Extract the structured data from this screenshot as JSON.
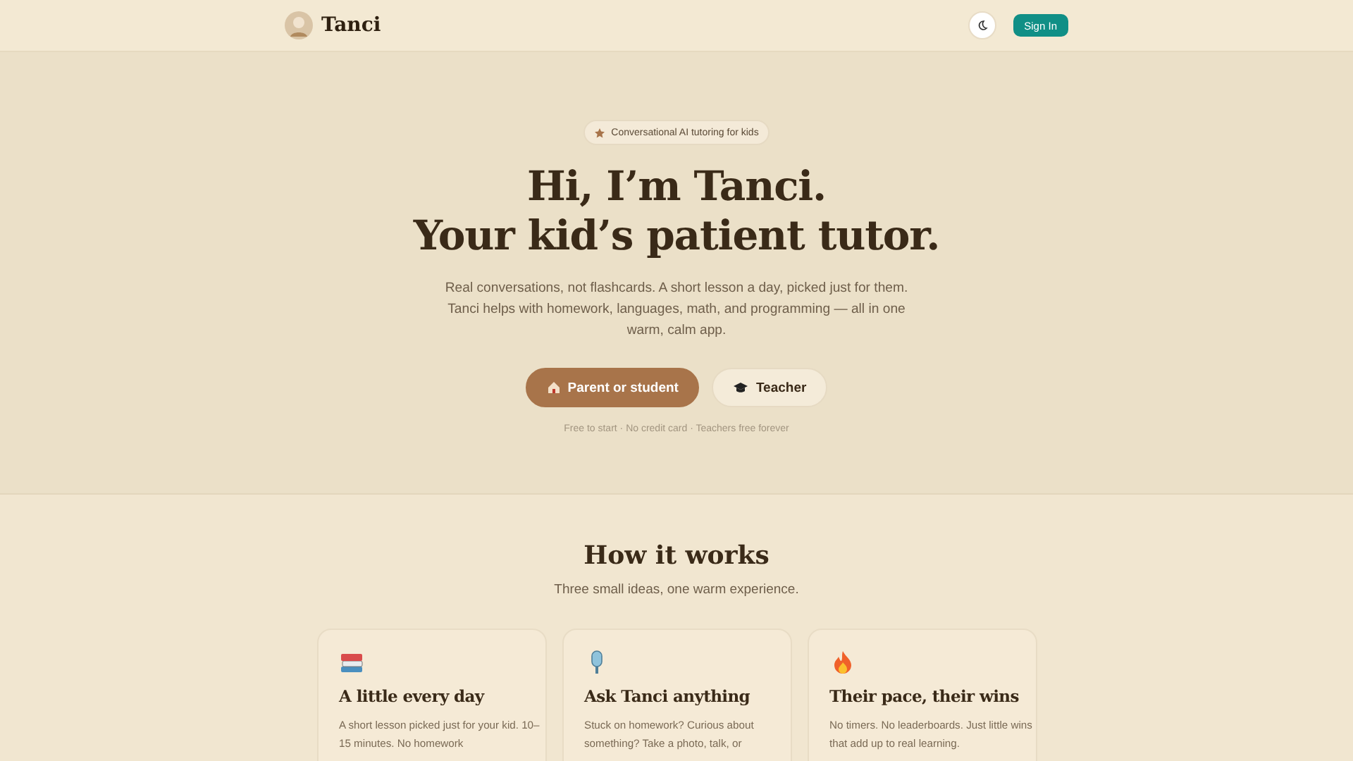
{
  "header": {
    "brand": "Tanci",
    "sign_in": "Sign In"
  },
  "hero": {
    "badge": "Conversational AI tutoring for kids",
    "title_lines": [
      "Hi, I’m Tanci.",
      "Your kid’s patient tutor."
    ],
    "intro": "Real conversations, not flashcards. A short lesson a day, picked just for them. Tanci helps with homework, languages, math, and programming — all in one warm, calm app.",
    "buttons": [
      {
        "label": "Parent or student",
        "kind": "primary"
      },
      {
        "label": "Teacher",
        "kind": "secondary"
      }
    ],
    "footnote": "Free to start · No credit card · Teachers free forever"
  },
  "how": {
    "title": "How it works",
    "subtitle": "Three small ideas, one warm experience.",
    "cards": [
      {
        "kind": "books",
        "title": "A little every day",
        "body": "A short lesson picked just for your kid. 10–15 minutes. No homework"
      },
      {
        "kind": "mic",
        "title": "Ask Tanci anything",
        "body": "Stuck on homework? Curious about something? Take a photo, talk, or"
      },
      {
        "kind": "fire",
        "title": "Their pace, their wins",
        "body": "No timers. No leaderboards. Just little wins that add up to real learning."
      }
    ]
  }
}
